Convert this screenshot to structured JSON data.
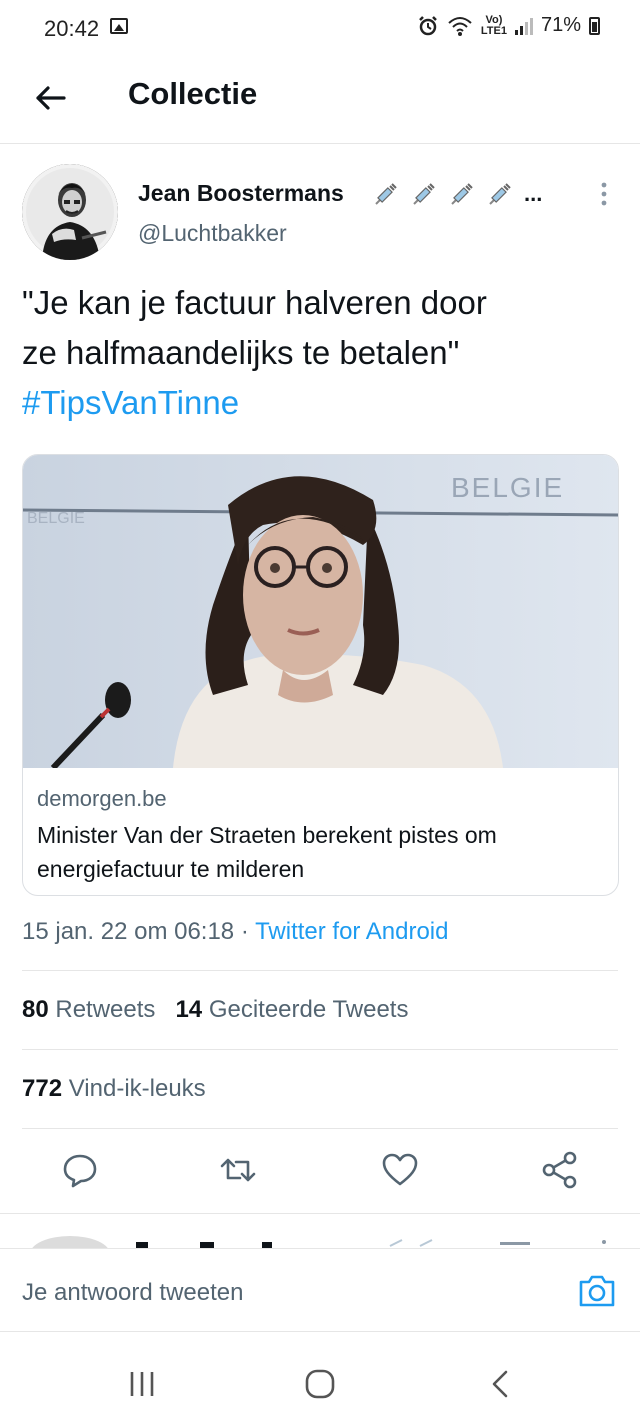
{
  "status_bar": {
    "time": "20:42",
    "battery": "71%",
    "network": "VoLTE1",
    "icons": [
      "image-icon",
      "alarm-icon",
      "wifi-icon",
      "signal-icon",
      "battery-icon"
    ]
  },
  "header": {
    "title": "Collectie",
    "back_icon": "back-arrow-icon"
  },
  "tweet": {
    "author_name": "Jean Boostermans",
    "author_emoji": [
      "syringe",
      "syringe",
      "syringe",
      "syringe"
    ],
    "author_name_ellipsis": "...",
    "handle": "@Luchtbakker",
    "text_line1": "\"Je kan je factuur halveren door",
    "text_line2": "ze halfmaandelijks te betalen\"",
    "hashtag": "#TipsVanTinne",
    "card": {
      "image_sign_text": "BELGIE",
      "image_sign_text_left": "BELGIE",
      "domain": "demorgen.be",
      "title": "Minister Van der Straeten berekent pistes om energiefactuur te milderen"
    },
    "timestamp": "15 jan. 22 om 06:18",
    "separator": " · ",
    "source": "Twitter for Android",
    "retweets_count": "80",
    "retweets_label": "Retweets",
    "quotes_count": "14",
    "quotes_label": "Geciteerde Tweets",
    "likes_count": "772",
    "likes_label": "Vind-ik-leuks"
  },
  "reply": {
    "placeholder": "Je antwoord tweeten"
  },
  "colors": {
    "accent": "#1d9bf0",
    "text": "#0f1419",
    "secondary": "#536471"
  }
}
